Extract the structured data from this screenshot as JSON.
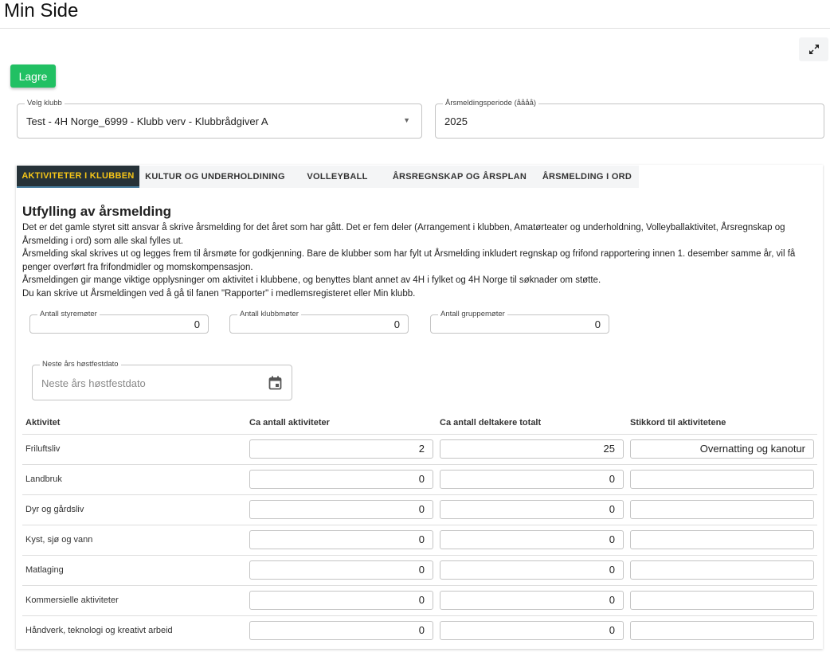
{
  "header": {
    "title": "Min Side"
  },
  "toolbar": {
    "save_label": "Lagre",
    "expand_icon": "expand-icon"
  },
  "club_select": {
    "label": "Velg klubb",
    "value": "Test - 4H Norge_6999 - Klubb verv - Klubbrådgiver A"
  },
  "period": {
    "label": "Årsmeldingsperiode (åååå)",
    "value": "2025"
  },
  "tabs": [
    {
      "label": "AKTIVITETER I KLUBBEN",
      "active": true
    },
    {
      "label": "KULTUR OG UNDERHOLDINING"
    },
    {
      "label": "VOLLEYBALL"
    },
    {
      "label": "ÅRSREGNSKAP OG ÅRSPLAN"
    },
    {
      "label": "ÅRSMELDING I ORD"
    }
  ],
  "main": {
    "heading": "Utfylling av årsmelding",
    "paragraphs": [
      "Det er det gamle styret sitt ansvar å skrive årsmelding for det året som har gått. Det er fem deler (Arrangement i klubben, Amatørteater og underholdning, Volleyballaktivitet, Årsregnskap og Årsmelding i ord) som alle skal fylles ut.",
      "Årsmelding skal skrives ut og legges frem til årsmøte for godkjenning. Bare de klubber som har fylt ut Årsmelding inkludert regnskap og frifond rapportering innen 1. desember samme år, vil få penger overført fra frifondmidler og momskompensasjon.",
      "Årsmeldingen gir mange viktige opplysninger om aktivitet i klubbene, og benyttes blant annet av 4H i fylket og 4H Norge til søknader om støtte.",
      "Du kan skrive ut Årsmeldingen ved å gå til fanen \"Rapporter\" i medlemsregisteret eller Min klubb."
    ],
    "counts": [
      {
        "label": "Antall styremøter",
        "value": "0"
      },
      {
        "label": "Antall klubbmøter",
        "value": "0"
      },
      {
        "label": "Antall gruppemøter",
        "value": "0"
      }
    ],
    "date": {
      "label": "Neste års høstfestdato",
      "placeholder": "Neste års høstfestdato"
    },
    "table": {
      "headers": [
        "Aktivitet",
        "Ca antall aktiviteter",
        "Ca antall deltakere totalt",
        "Stikkord til aktivitetene"
      ],
      "rows": [
        {
          "name": "Friluftsliv",
          "count": "2",
          "participants": "25",
          "keywords": "Overnatting og kanotur"
        },
        {
          "name": "Landbruk",
          "count": "0",
          "participants": "0",
          "keywords": ""
        },
        {
          "name": "Dyr og gårdsliv",
          "count": "0",
          "participants": "0",
          "keywords": ""
        },
        {
          "name": "Kyst, sjø og vann",
          "count": "0",
          "participants": "0",
          "keywords": ""
        },
        {
          "name": "Matlaging",
          "count": "0",
          "participants": "0",
          "keywords": ""
        },
        {
          "name": "Kommersielle aktiviteter",
          "count": "0",
          "participants": "0",
          "keywords": ""
        },
        {
          "name": "Håndverk, teknologi og kreativt arbeid",
          "count": "0",
          "participants": "0",
          "keywords": ""
        }
      ]
    }
  }
}
